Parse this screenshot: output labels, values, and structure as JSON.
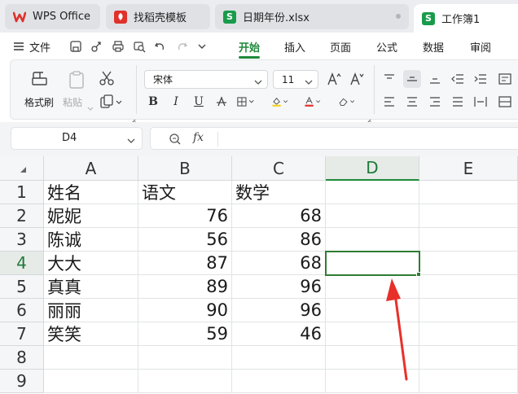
{
  "tabs": [
    {
      "label": "WPS Office",
      "icon": "wps-logo-icon"
    },
    {
      "label": "找稻壳模板",
      "icon": "docer-icon"
    },
    {
      "label": "日期年份.xlsx",
      "icon": "spreadsheet-icon",
      "icon_letter": "S"
    },
    {
      "label": "工作簿1",
      "icon": "spreadsheet-icon",
      "icon_letter": "S"
    }
  ],
  "menu": {
    "file": "文件",
    "items": [
      "开始",
      "插入",
      "页面",
      "公式",
      "数据",
      "审阅"
    ],
    "active": "开始"
  },
  "ribbon": {
    "format_painter": "格式刷",
    "paste": "粘贴",
    "font_name": "宋体",
    "font_size": "11"
  },
  "formula_bar": {
    "name_box": "D4",
    "fx": "fx",
    "formula": ""
  },
  "sheet": {
    "columns": [
      "A",
      "B",
      "C",
      "D",
      "E"
    ],
    "rows": [
      "1",
      "2",
      "3",
      "4",
      "5",
      "6",
      "7",
      "8",
      "9"
    ],
    "active_cell": "D4",
    "cells": [
      [
        "姓名",
        "语文",
        "数学",
        "",
        ""
      ],
      [
        "妮妮",
        "76",
        "68",
        "",
        ""
      ],
      [
        "陈诚",
        "56",
        "86",
        "",
        ""
      ],
      [
        "大大",
        "87",
        "68",
        "",
        ""
      ],
      [
        "真真",
        "89",
        "96",
        "",
        ""
      ],
      [
        "丽丽",
        "90",
        "96",
        "",
        ""
      ],
      [
        "笑笑",
        "59",
        "46",
        "",
        ""
      ],
      [
        "",
        "",
        "",
        "",
        ""
      ],
      [
        "",
        "",
        "",
        "",
        ""
      ]
    ]
  },
  "colors": {
    "accent": "#1f8a3c",
    "wps_red": "#e0312b",
    "sheet_green": "#1a9b4b",
    "arrow_red": "#e8302a"
  }
}
